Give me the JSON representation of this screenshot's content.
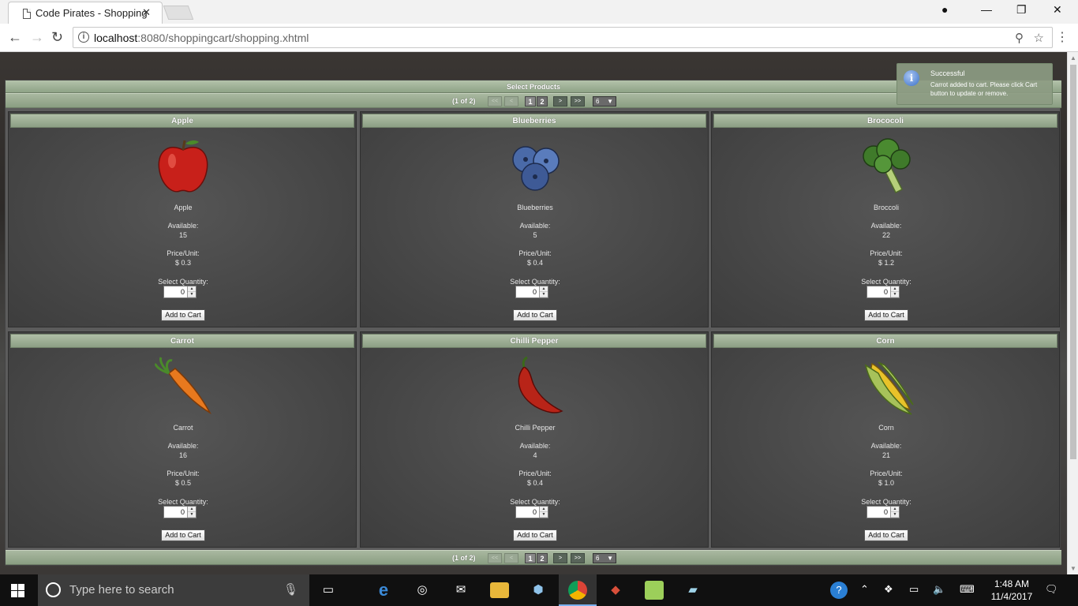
{
  "browser": {
    "tab_title": "Code Pirates - Shopping",
    "tab_close": "✕",
    "url_host": "localhost",
    "url_rest": ":8080/shoppingcart/shopping.xhtml"
  },
  "page": {
    "header": "Select Products",
    "pager": {
      "current": "(1 of 2)",
      "first": "<<",
      "prev": "<",
      "pages": [
        "1",
        "2"
      ],
      "next": ">",
      "last": ">>",
      "rows_per_page": "6"
    },
    "labels": {
      "available": "Available:",
      "price": "Price/Unit:",
      "quantity": "Select Quantity:",
      "add_to_cart": "Add to Cart"
    },
    "products": [
      {
        "title": "Apple",
        "name": "Apple",
        "available": "15",
        "price": "$ 0.3",
        "qty": "0",
        "icon": "apple-icon"
      },
      {
        "title": "Blueberries",
        "name": "Blueberries",
        "available": "5",
        "price": "$ 0.4",
        "qty": "0",
        "icon": "blueberries-icon"
      },
      {
        "title": "Brococoli",
        "name": "Broccoli",
        "available": "22",
        "price": "$ 1.2",
        "qty": "0",
        "icon": "broccoli-icon"
      },
      {
        "title": "Carrot",
        "name": "Carrot",
        "available": "16",
        "price": "$ 0.5",
        "qty": "0",
        "icon": "carrot-icon"
      },
      {
        "title": "Chilli Pepper",
        "name": "Chilli Pepper",
        "available": "4",
        "price": "$ 0.4",
        "qty": "0",
        "icon": "chilli-pepper-icon"
      },
      {
        "title": "Corn",
        "name": "Corn",
        "available": "21",
        "price": "$ 1.0",
        "qty": "0",
        "icon": "corn-icon"
      }
    ],
    "growl": {
      "title": "Successful",
      "message": "Carrot added to cart. Please click Cart button to update or remove."
    }
  },
  "taskbar": {
    "search_placeholder": "Type here to search",
    "time": "1:48 AM",
    "date": "11/4/2017"
  }
}
